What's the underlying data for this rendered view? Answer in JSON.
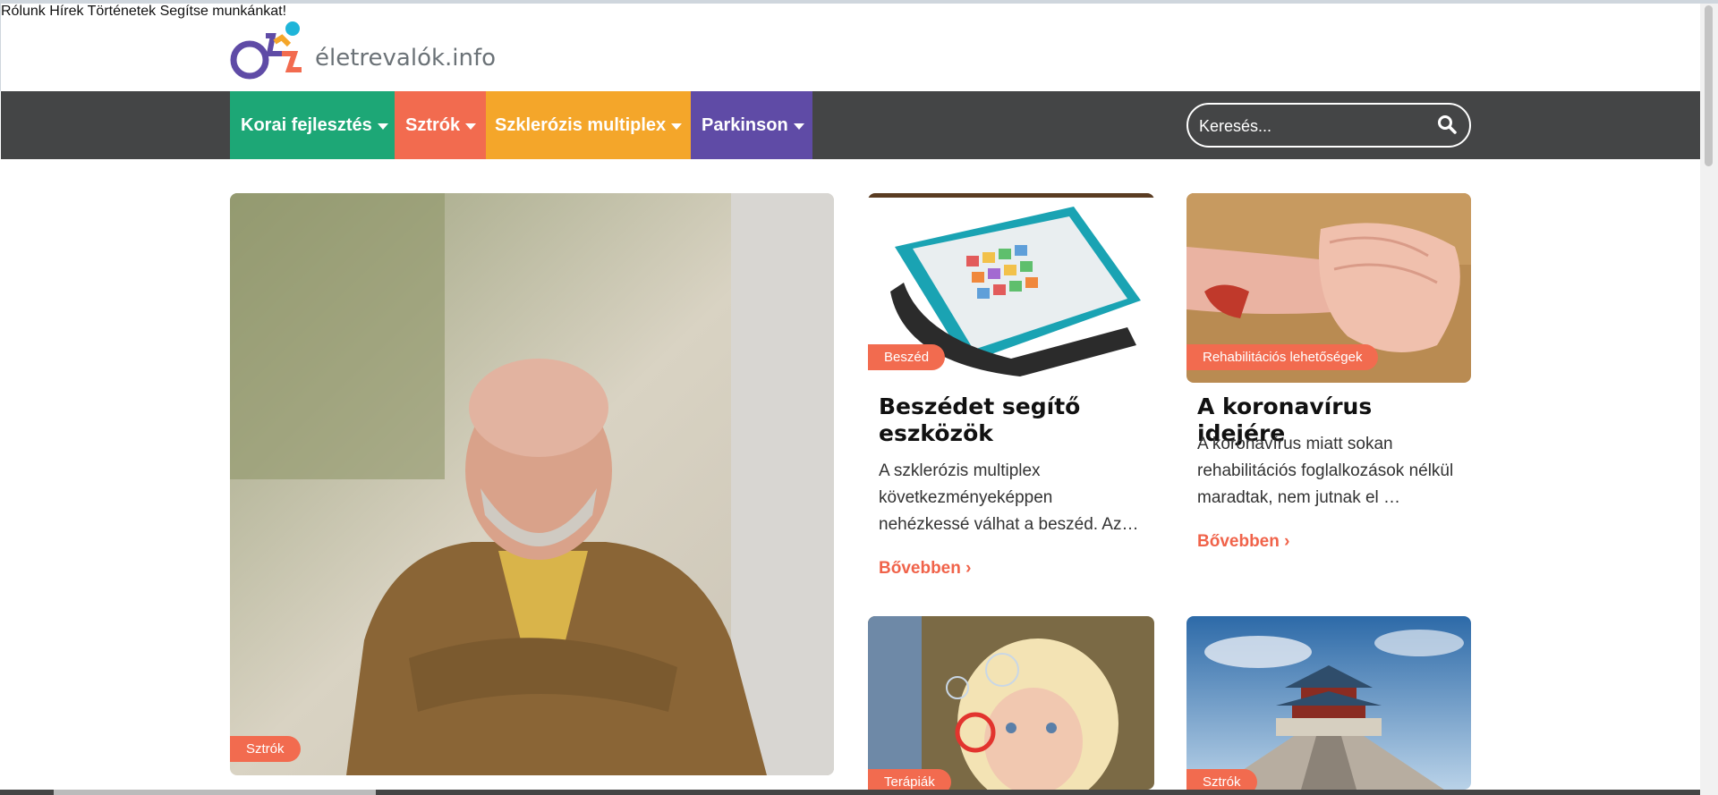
{
  "header": {
    "logo_text": "életrevalók.info",
    "nav": [
      "Rólunk",
      "Hírek",
      "Történetek",
      "Segítse munkánkat!"
    ]
  },
  "categories": [
    {
      "label": "Korai fejlesztés",
      "color": "#1da776"
    },
    {
      "label": "Sztrók",
      "color": "#f26b4f"
    },
    {
      "label": "Szklerózis multiplex",
      "color": "#f4a62a"
    },
    {
      "label": "Parkinson",
      "color": "#5f4ba6"
    }
  ],
  "search": {
    "placeholder": "Keresés..."
  },
  "featured": {
    "badge": "Sztrók"
  },
  "cards": [
    {
      "badge": "Beszéd",
      "title": "Beszédet segítő eszközök",
      "excerpt": "A szklerózis multiplex következményeképpen nehézkessé válhat a beszéd. Az…",
      "more": "Bővebben"
    },
    {
      "badge": "Rehabilitációs lehetőségek",
      "title": "A koronavírus idejére",
      "excerpt": "A koronavírus miatt sokan rehabilitációs foglalkozások nélkül maradtak, nem jutnak el …",
      "more": "Bővebben"
    },
    {
      "badge": "Terápiák"
    },
    {
      "badge": "Sztrók"
    }
  ]
}
